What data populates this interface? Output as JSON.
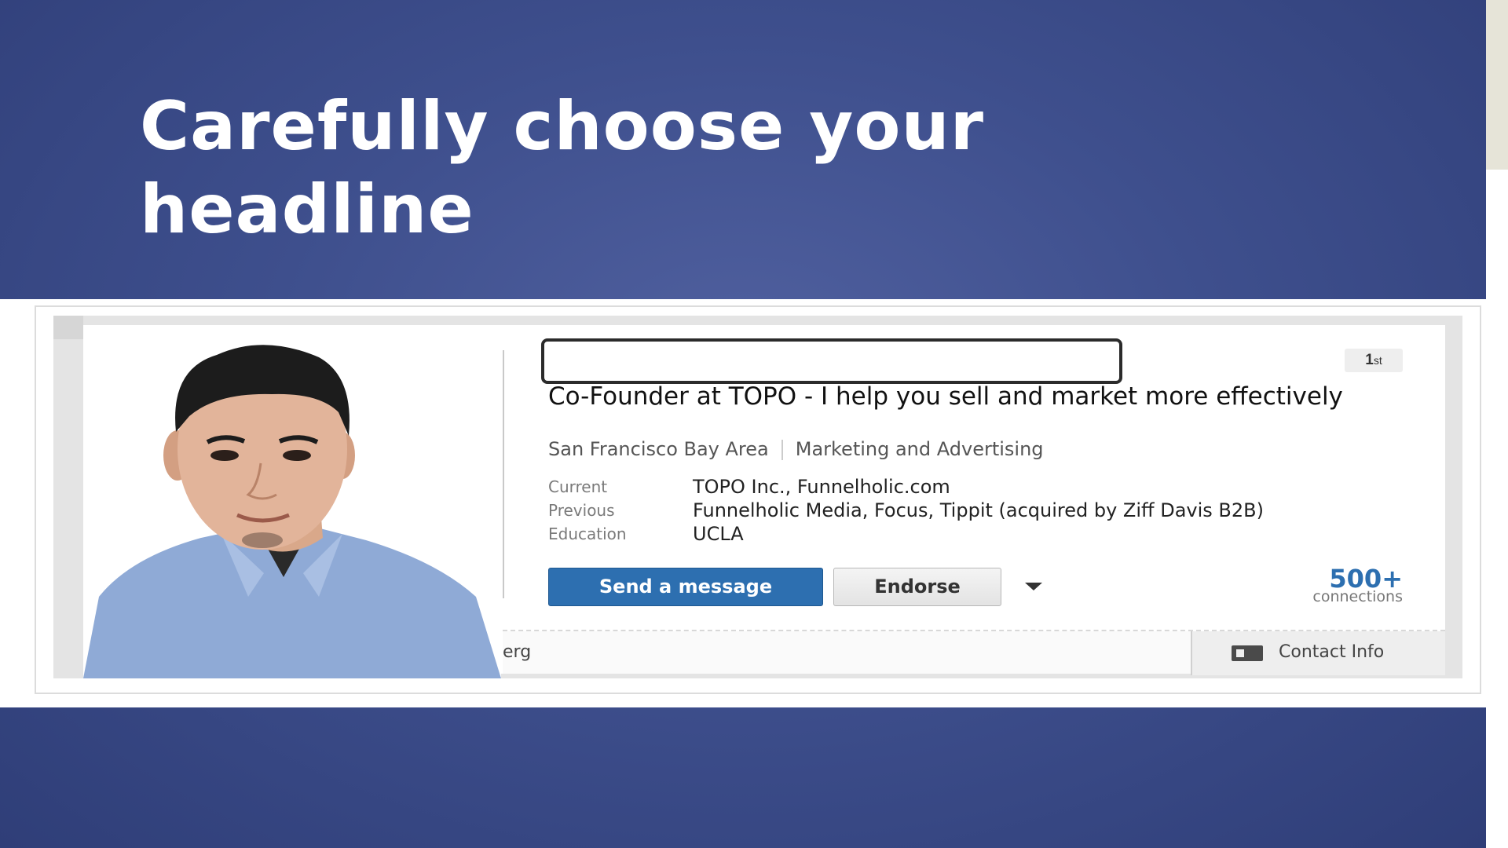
{
  "slide": {
    "title": "Carefully choose your headline"
  },
  "profile": {
    "degree": "1",
    "degree_suffix": "st",
    "headline": "Co-Founder at TOPO - I help you sell and market more effectively",
    "location": "San Francisco Bay Area",
    "industry": "Marketing and Advertising",
    "details": [
      {
        "label": "Current",
        "value": "TOPO Inc., Funnelholic.com"
      },
      {
        "label": "Previous",
        "value": "Funnelholic Media, Focus, Tippit (acquired by Ziff Davis B2B)"
      },
      {
        "label": "Education",
        "value": "UCLA"
      }
    ],
    "send_message_label": "Send a message",
    "endorse_label": "Endorse",
    "connections_count": "500+",
    "connections_label": "connections",
    "footer_url_fragment": "erg",
    "contact_info_label": "Contact Info"
  },
  "colors": {
    "slide_bg": "#3e4f8d",
    "primary_button": "#2d6fb0",
    "connections": "#2d6fb0"
  },
  "icons": [
    "dropdown-arrow-icon",
    "contact-card-icon"
  ]
}
